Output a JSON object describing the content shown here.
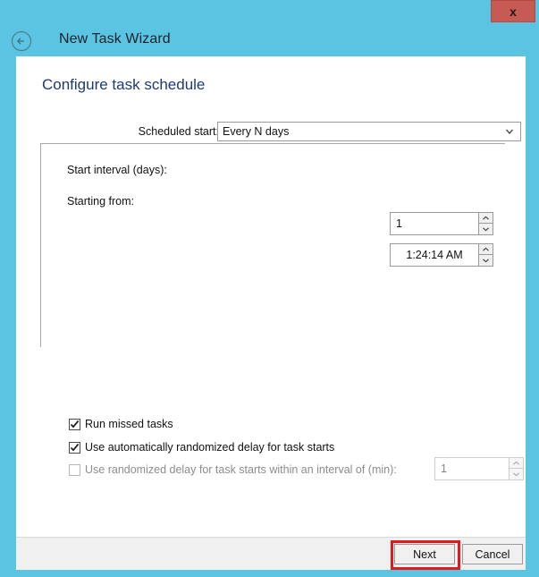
{
  "window": {
    "title": "New Task Wizard",
    "close_label": "x",
    "back_icon": "circled-left-arrow-icon",
    "accent_color": "#5bc4e2",
    "close_color": "#c75b54"
  },
  "page": {
    "heading": "Configure task schedule",
    "heading_color": "#1f3a70"
  },
  "scheduled_start": {
    "label": "Scheduled start:",
    "selected": "Every N days",
    "chevron_icon": "chevron-down-icon"
  },
  "group": {
    "interval": {
      "label": "Start interval (days):",
      "value": "1",
      "up_icon": "spinner-up-icon",
      "down_icon": "spinner-down-icon"
    },
    "starting_from": {
      "label": "Starting from:",
      "value": "1:24:14 AM",
      "up_icon": "spinner-up-icon",
      "down_icon": "spinner-down-icon"
    }
  },
  "options": {
    "run_missed": {
      "label": "Run missed tasks",
      "checked": true,
      "enabled": true,
      "check_icon": "checkmark-icon"
    },
    "auto_randomized": {
      "label": "Use automatically randomized delay for task starts",
      "checked": true,
      "enabled": true,
      "check_icon": "checkmark-icon"
    },
    "randomized_interval": {
      "label": "Use randomized delay for task starts within an interval of (min):",
      "checked": false,
      "enabled": false,
      "value": "1",
      "up_icon": "spinner-up-icon",
      "down_icon": "spinner-down-icon"
    }
  },
  "footer": {
    "next_label": "Next",
    "cancel_label": "Cancel",
    "highlight_color": "#e01b1b"
  }
}
